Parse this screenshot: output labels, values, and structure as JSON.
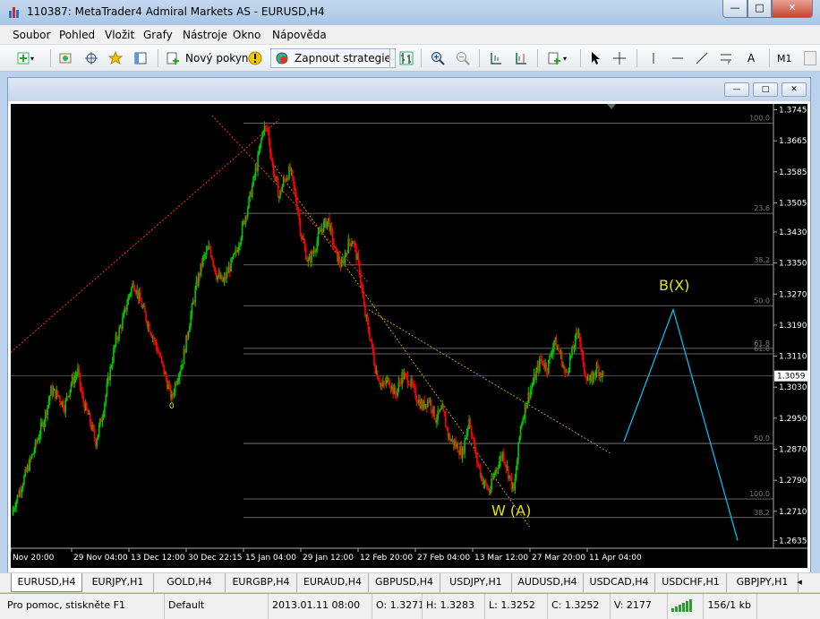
{
  "window": {
    "title": "110387: MetaTrader4 Admiral Markets AS - EURUSD,H4"
  },
  "menu": [
    "Soubor",
    "Pohled",
    "Vložit",
    "Grafy",
    "Nástroje",
    "Okno",
    "Nápověda"
  ],
  "toolbar": {
    "new_order": "Nový pokyn",
    "autotrading": "Zapnout strategie",
    "period": "M1",
    "text_tool": "A"
  },
  "tabs": [
    "EURUSD,H4",
    "EURJPY,H1",
    "GOLD,H4",
    "EURGBP,H4",
    "EURAUD,H4",
    "GBPUSD,H4",
    "USDJPY,H1",
    "AUDUSD,H4",
    "USDCAD,H4",
    "USDCHF,H1",
    "GBPJPY,H1"
  ],
  "status": {
    "help": "Pro pomoc, stiskněte F1",
    "profile": "Default",
    "datetime": "2013.01.11 08:00",
    "open": "O: 1.3271",
    "high": "H: 1.3283",
    "low": "L: 1.3252",
    "close": "C: 1.3252",
    "volume": "V: 2177",
    "traffic": "156/1 kb"
  },
  "colors": {
    "background": "#000000",
    "bull": "#00c800",
    "bear": "#ff0000",
    "fib": "#ff3300",
    "wave_label": "#e6e600",
    "projection": "#00c8ff",
    "grid": "#ffffff"
  },
  "chart_data": {
    "type": "candlestick",
    "symbol": "EURUSD",
    "timeframe": "H4",
    "y_ticks": [
      "1.3745",
      "1.3665",
      "1.3585",
      "1.3505",
      "1.3430",
      "1.3350",
      "1.3270",
      "1.3190",
      "1.3110",
      "1.3030",
      "1.2950",
      "1.2870",
      "1.2790",
      "1.2710",
      "1.2635"
    ],
    "ylim": [
      1.2615,
      1.376
    ],
    "current_price": "1.3059",
    "x_ticks": [
      "Nov 20:00",
      "29 Nov 04:00",
      "13 Dec 12:00",
      "30 Dec 22:15",
      "15 Jan 04:00",
      "29 Jan 12:00",
      "12 Feb 20:00",
      "27 Feb 04:00",
      "13 Mar 12:00",
      "27 Mar 20:00",
      "11 Apr 04:00"
    ],
    "fib_levels": [
      {
        "label": "100.0",
        "price": 1.371
      },
      {
        "label": "23.6",
        "price": 1.3478
      },
      {
        "label": "38.2",
        "price": 1.3345
      },
      {
        "label": "50.0",
        "price": 1.324
      },
      {
        "label": "61.8",
        "price": 1.313
      },
      {
        "label": "61.8",
        "price": 1.3116
      },
      {
        "label": "50.0",
        "price": 1.2885
      },
      {
        "label": "100.0",
        "price": 1.2742
      },
      {
        "label": "38.2",
        "price": 1.2694
      }
    ],
    "wave_labels": [
      "W (A)",
      "B(X)"
    ],
    "pivot_marker": "0",
    "path": [
      [
        0,
        1.27
      ],
      [
        5,
        1.278
      ],
      [
        10,
        1.286
      ],
      [
        15,
        1.295
      ],
      [
        18,
        1.302
      ],
      [
        21,
        1.301
      ],
      [
        24,
        1.298
      ],
      [
        27,
        1.304
      ],
      [
        30,
        1.307
      ],
      [
        32,
        1.3
      ],
      [
        35,
        1.295
      ],
      [
        38,
        1.289
      ],
      [
        41,
        1.296
      ],
      [
        44,
        1.306
      ],
      [
        47,
        1.315
      ],
      [
        50,
        1.32
      ],
      [
        53,
        1.327
      ],
      [
        55,
        1.33
      ],
      [
        58,
        1.325
      ],
      [
        61,
        1.32
      ],
      [
        63,
        1.317
      ],
      [
        66,
        1.312
      ],
      [
        69,
        1.306
      ],
      [
        72,
        1.3
      ],
      [
        74,
        1.305
      ],
      [
        77,
        1.31
      ],
      [
        80,
        1.32
      ],
      [
        83,
        1.329
      ],
      [
        86,
        1.336
      ],
      [
        89,
        1.339
      ],
      [
        92,
        1.332
      ],
      [
        95,
        1.33
      ],
      [
        98,
        1.334
      ],
      [
        101,
        1.338
      ],
      [
        104,
        1.345
      ],
      [
        107,
        1.352
      ],
      [
        110,
        1.36
      ],
      [
        113,
        1.37
      ],
      [
        115,
        1.369
      ],
      [
        117,
        1.36
      ],
      [
        120,
        1.352
      ],
      [
        122,
        1.356
      ],
      [
        125,
        1.359
      ],
      [
        128,
        1.35
      ],
      [
        130,
        1.342
      ],
      [
        133,
        1.335
      ],
      [
        136,
        1.339
      ],
      [
        139,
        1.344
      ],
      [
        142,
        1.346
      ],
      [
        145,
        1.338
      ],
      [
        148,
        1.334
      ],
      [
        151,
        1.34
      ],
      [
        153,
        1.341
      ],
      [
        156,
        1.333
      ],
      [
        158,
        1.323
      ],
      [
        161,
        1.315
      ],
      [
        163,
        1.308
      ],
      [
        166,
        1.303
      ],
      [
        169,
        1.305
      ],
      [
        172,
        1.301
      ],
      [
        175,
        1.306
      ],
      [
        178,
        1.305
      ],
      [
        181,
        1.301
      ],
      [
        184,
        1.298
      ],
      [
        187,
        1.3
      ],
      [
        190,
        1.295
      ],
      [
        193,
        1.297
      ],
      [
        196,
        1.29
      ],
      [
        199,
        1.288
      ],
      [
        202,
        1.286
      ],
      [
        205,
        1.295
      ],
      [
        208,
        1.285
      ],
      [
        211,
        1.279
      ],
      [
        214,
        1.276
      ],
      [
        217,
        1.282
      ],
      [
        220,
        1.286
      ],
      [
        223,
        1.28
      ],
      [
        225,
        1.276
      ],
      [
        228,
        1.293
      ],
      [
        231,
        1.3
      ],
      [
        234,
        1.305
      ],
      [
        237,
        1.31
      ],
      [
        240,
        1.308
      ],
      [
        243,
        1.315
      ],
      [
        246,
        1.311
      ],
      [
        248,
        1.306
      ],
      [
        251,
        1.312
      ],
      [
        254,
        1.318
      ],
      [
        256,
        1.308
      ],
      [
        259,
        1.304
      ],
      [
        262,
        1.308
      ],
      [
        265,
        1.3059
      ]
    ],
    "projection": [
      [
        0,
        1.289
      ],
      [
        1,
        1.323
      ],
      [
        2,
        1.2635
      ]
    ]
  }
}
